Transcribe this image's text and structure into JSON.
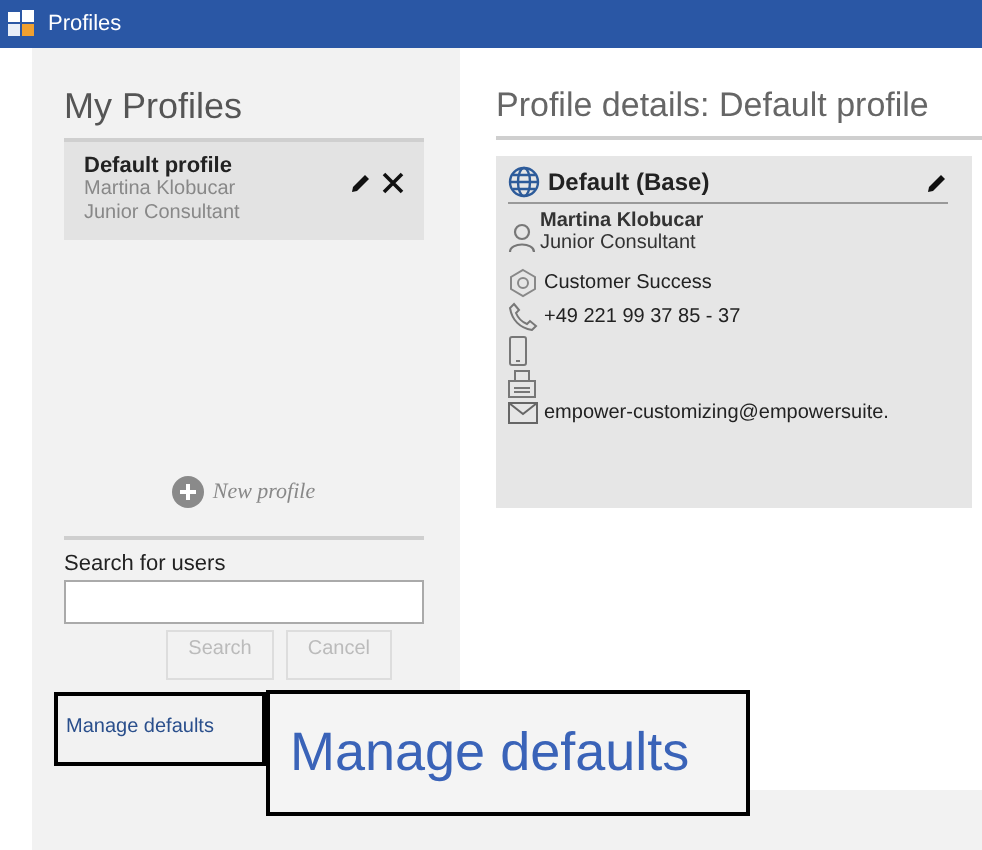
{
  "window": {
    "title": "Profiles"
  },
  "my_profiles": {
    "heading": "My Profiles",
    "profiles": [
      {
        "name": "Default profile",
        "person": "Martina Klobucar",
        "role": "Junior Consultant",
        "selected": true
      }
    ],
    "new_profile": "New profile"
  },
  "search": {
    "label": "Search for users",
    "buttons": [
      {
        "label": "Search",
        "disabled": true
      },
      {
        "label": "Cancel",
        "disabled": true
      }
    ]
  },
  "manage_link": "Manage defaults",
  "callout": {
    "text": "Manage defaults"
  },
  "details": {
    "heading": "Profile details: Default profile",
    "card": {
      "title": "Default (Base)",
      "name": "Martina Klobucar",
      "role": "Junior Consultant",
      "rows": [
        {
          "kind": "department",
          "text": "Customer Success"
        },
        {
          "kind": "phone",
          "text": "+49 221 99 37 85 - 37"
        },
        {
          "kind": "mobile"
        },
        {
          "kind": "fax"
        },
        {
          "kind": "email",
          "text": "empower-customizing@empowersuite."
        }
      ]
    }
  }
}
